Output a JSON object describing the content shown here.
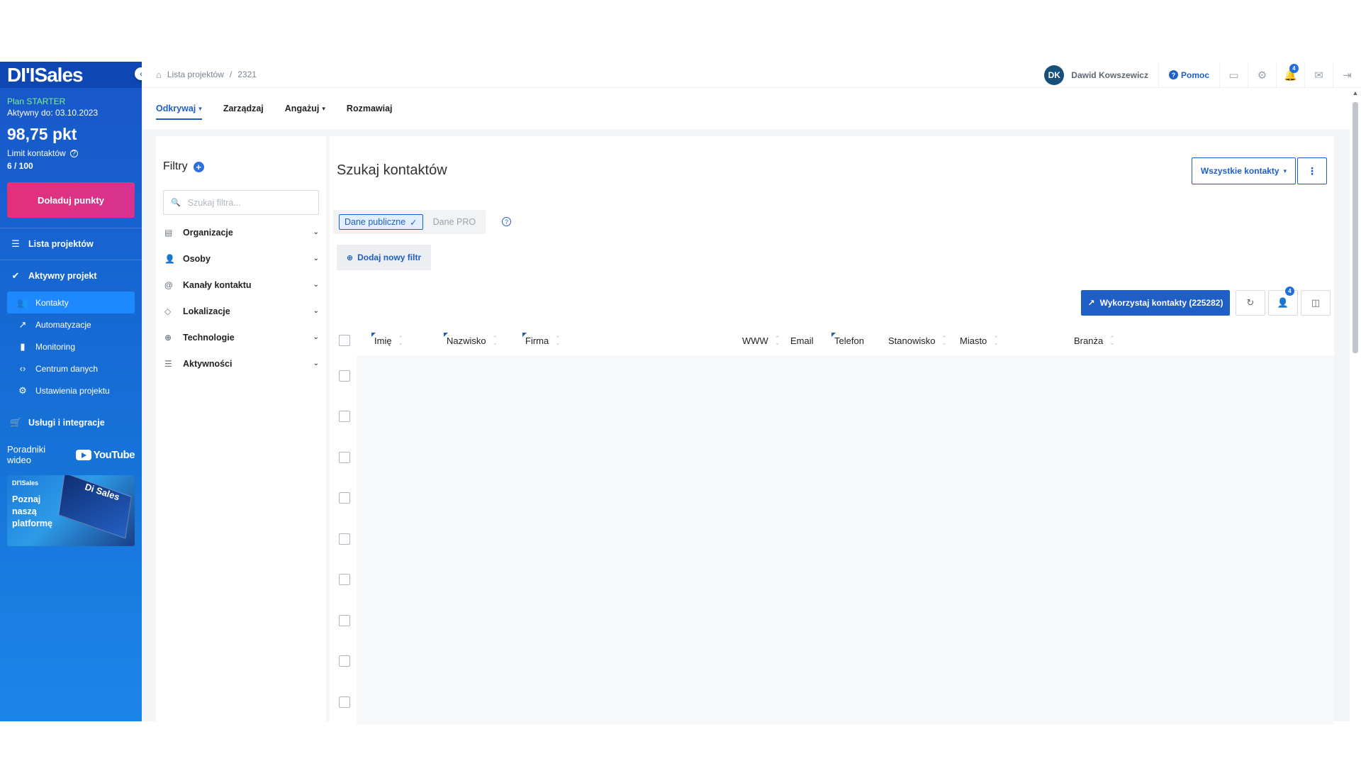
{
  "sidebar": {
    "logo": "DI'ISales",
    "plan_name": "Plan STARTER",
    "active_until": "Aktywny do: 03.10.2023",
    "points": "98,75 pkt",
    "limit_label": "Limit kontaktów",
    "limit_value": "6 / 100",
    "topup_button": "Doładuj punkty",
    "projects_list": "Lista projektów",
    "active_project": "Aktywny projekt",
    "submenu": [
      "Kontakty",
      "Automatyzacje",
      "Monitoring",
      "Centrum danych",
      "Ustawienia projektu"
    ],
    "services": "Usługi i integracje",
    "video_label": "Poradniki wideo",
    "youtube": "YouTube",
    "promo_brand": "DI'ISales",
    "promo_text": "Poznaj naszą platformę",
    "promo_screen": "Di Sales"
  },
  "header": {
    "breadcrumb_root": "Lista projektów",
    "breadcrumb_sep": "/",
    "breadcrumb_current": "2321",
    "avatar_initials": "DK",
    "user_name": "Dawid Kowszewicz",
    "help": "Pomoc",
    "notification_count": "4"
  },
  "tabs": {
    "discover": "Odkrywaj",
    "manage": "Zarządzaj",
    "engage": "Angażuj",
    "talk": "Rozmawiaj"
  },
  "filters": {
    "title": "Filtry",
    "search_placeholder": "Szukaj filtra...",
    "items": [
      "Organizacje",
      "Osoby",
      "Kanały kontaktu",
      "Lokalizacje",
      "Technologie",
      "Aktywności"
    ]
  },
  "main": {
    "title": "Szukaj kontaktów",
    "all_contacts": "Wszystkie kontakty",
    "public_data": "Dane publiczne",
    "pro_data": "Dane PRO",
    "add_filter": "Dodaj nowy filtr",
    "use_contacts": "Wykorzystaj kontakty (225282)",
    "assign_badge": "4",
    "columns": [
      "Imię",
      "Nazwisko",
      "Firma",
      "WWW",
      "Email",
      "Telefon",
      "Stanowisko",
      "Miasto",
      "Branża"
    ]
  },
  "colors": {
    "primary": "#1f5fc5",
    "sidebar": "#1856c8",
    "accent_pink": "#e4307a",
    "plan_green": "#7df28e"
  }
}
